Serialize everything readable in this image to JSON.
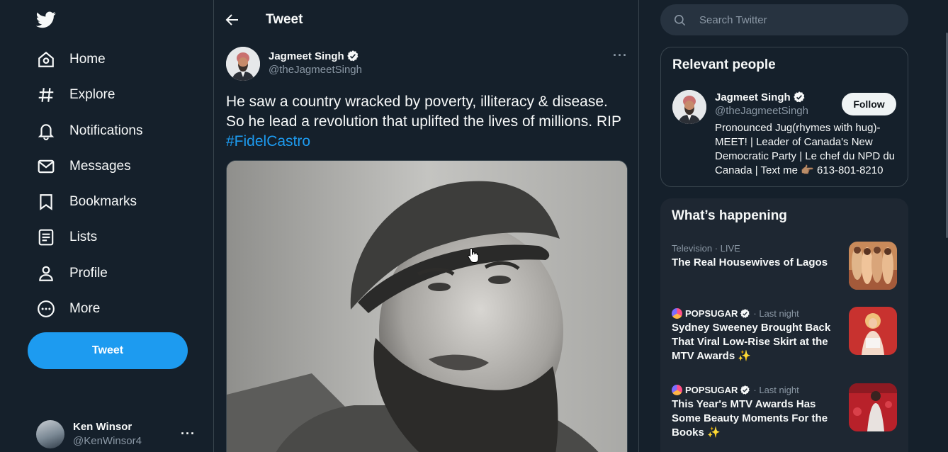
{
  "nav": {
    "items": [
      {
        "label": "Home",
        "icon": "home-icon"
      },
      {
        "label": "Explore",
        "icon": "hashtag-icon"
      },
      {
        "label": "Notifications",
        "icon": "bell-icon"
      },
      {
        "label": "Messages",
        "icon": "envelope-icon"
      },
      {
        "label": "Bookmarks",
        "icon": "bookmark-icon"
      },
      {
        "label": "Lists",
        "icon": "list-icon"
      },
      {
        "label": "Profile",
        "icon": "person-icon"
      },
      {
        "label": "More",
        "icon": "more-circle-icon"
      }
    ],
    "tweet_button": "Tweet"
  },
  "account": {
    "name": "Ken Winsor",
    "handle": "@KenWinsor4",
    "more": "···"
  },
  "main": {
    "title": "Tweet",
    "tweet": {
      "author_name": "Jagmeet Singh",
      "author_handle": "@theJagmeetSingh",
      "more": "···",
      "text": "He saw a country wracked by poverty, illiteracy & disease. So he lead a revolution that uplifted the lives of millions. RIP ",
      "hashtag": "#FidelCastro"
    }
  },
  "search": {
    "placeholder": "Search Twitter"
  },
  "relevant_people": {
    "title": "Relevant people",
    "person": {
      "name": "Jagmeet Singh",
      "handle": "@theJagmeetSingh",
      "follow": "Follow",
      "bio": "Pronounced Jug(rhymes with hug)-MEET! | Leader of Canada's New Democratic Party | Le chef du NPD du Canada | Text me 👉🏽 613-801-8210"
    }
  },
  "whats_happening": {
    "title": "What’s happening",
    "trends": [
      {
        "source": "",
        "meta": "Television · LIVE",
        "headline": "The Real Housewives of Lagos"
      },
      {
        "source": "POPSUGAR",
        "meta": "· Last night",
        "headline": "Sydney Sweeney Brought Back That Viral Low-Rise Skirt at the MTV Awards ✨"
      },
      {
        "source": "POPSUGAR",
        "meta": "· Last night",
        "headline": "This Year's MTV Awards Has Some Beauty Moments For the Books ✨"
      }
    ]
  },
  "colors": {
    "background": "#15202b",
    "accent": "#1d9bf0",
    "muted": "#8b98a5",
    "border": "#38444d"
  }
}
